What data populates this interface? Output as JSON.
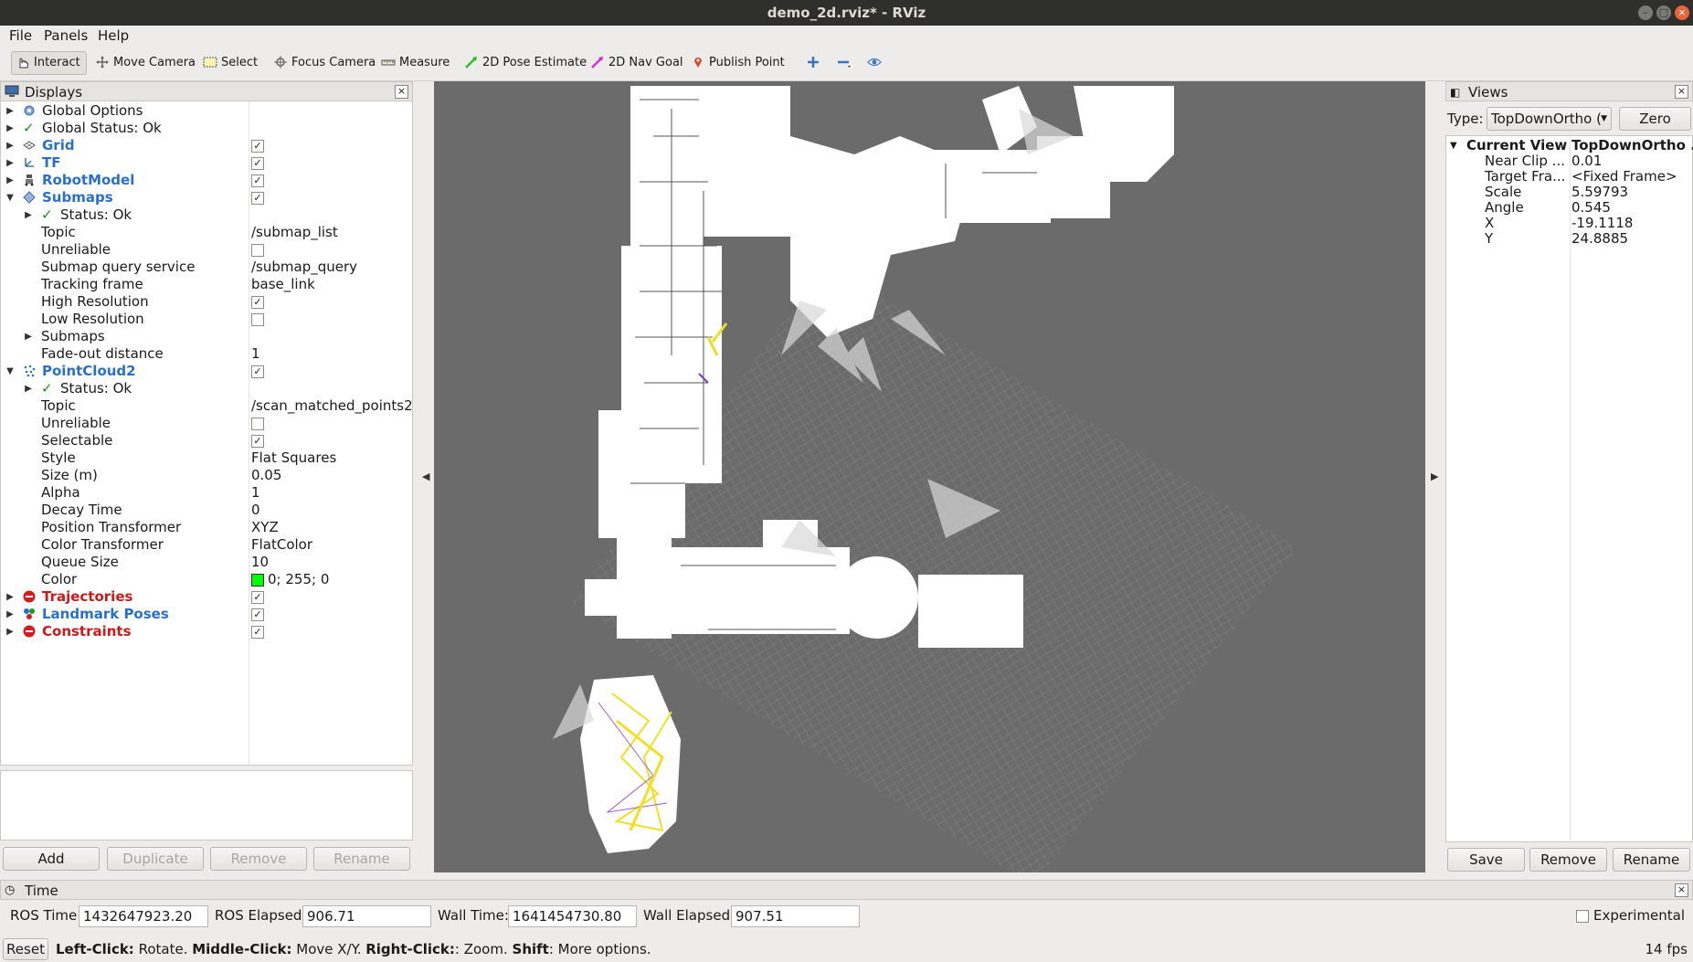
{
  "window": {
    "title": "demo_2d.rviz* - RViz"
  },
  "menu": [
    "File",
    "Panels",
    "Help"
  ],
  "toolbar": {
    "interact": "Interact",
    "move_camera": "Move Camera",
    "select": "Select",
    "focus_camera": "Focus Camera",
    "measure": "Measure",
    "pose_estimate": "2D Pose Estimate",
    "nav_goal": "2D Nav Goal",
    "publish_point": "Publish Point"
  },
  "displays": {
    "title": "Displays",
    "rows": {
      "global_options": "Global Options",
      "global_status": "Global Status: Ok",
      "grid": "Grid",
      "tf": "TF",
      "robot_model": "RobotModel",
      "submaps": "Submaps",
      "submaps_status": "Status: Ok",
      "topic": "Topic",
      "topic_val": "/submap_list",
      "unreliable": "Unreliable",
      "query_service": "Submap query service",
      "query_service_val": "/submap_query",
      "tracking_frame": "Tracking frame",
      "tracking_frame_val": "base_link",
      "high_res": "High Resolution",
      "low_res": "Low Resolution",
      "submaps_child": "Submaps",
      "fade_out": "Fade-out distance",
      "fade_out_val": "1",
      "pointcloud2": "PointCloud2",
      "pc_status": "Status: Ok",
      "pc_topic": "Topic",
      "pc_topic_val": "/scan_matched_points2",
      "pc_unreliable": "Unreliable",
      "selectable": "Selectable",
      "style": "Style",
      "style_val": "Flat Squares",
      "size": "Size (m)",
      "size_val": "0.05",
      "alpha": "Alpha",
      "alpha_val": "1",
      "decay": "Decay Time",
      "decay_val": "0",
      "pos_transformer": "Position Transformer",
      "pos_transformer_val": "XYZ",
      "color_transformer": "Color Transformer",
      "color_transformer_val": "FlatColor",
      "queue_size": "Queue Size",
      "queue_size_val": "10",
      "color": "Color",
      "color_val": "0; 255; 0",
      "trajectories": "Trajectories",
      "landmark_poses": "Landmark Poses",
      "constraints": "Constraints"
    },
    "buttons": {
      "add": "Add",
      "duplicate": "Duplicate",
      "remove": "Remove",
      "rename": "Rename"
    }
  },
  "views": {
    "title": "Views",
    "type_label": "Type:",
    "type_value": "TopDownOrtho (",
    "zero": "Zero",
    "current_view": "Current View",
    "current_view_val": "TopDownOrtho ...",
    "props": [
      {
        "k": "Near Clip ...",
        "v": "0.01"
      },
      {
        "k": "Target Fra...",
        "v": "<Fixed Frame>"
      },
      {
        "k": "Scale",
        "v": "5.59793"
      },
      {
        "k": "Angle",
        "v": "0.545"
      },
      {
        "k": "X",
        "v": "-19.1118"
      },
      {
        "k": "Y",
        "v": "24.8885"
      }
    ],
    "save": "Save",
    "remove": "Remove",
    "rename": "Rename"
  },
  "time": {
    "title": "Time",
    "ros_time_label": "ROS Time:",
    "ros_time": "1432647923.20",
    "ros_elapsed_label": "ROS Elapsed:",
    "ros_elapsed": "906.71",
    "wall_time_label": "Wall Time:",
    "wall_time": "1641454730.80",
    "wall_elapsed_label": "Wall Elapsed:",
    "wall_elapsed": "907.51",
    "experimental": "Experimental"
  },
  "status": {
    "reset": "Reset",
    "left_click": "Left-Click:",
    "left_click_text": " Rotate. ",
    "middle_click": "Middle-Click:",
    "middle_click_text": " Move X/Y. ",
    "right_click": "Right-Click:",
    "right_click_text": ": Zoom. ",
    "shift": "Shift",
    "shift_text": ": More options.",
    "fps": "14 fps"
  },
  "colors": {
    "accent_blue": "#2a6fc9",
    "error_red": "#cc1b1b",
    "pointcloud_color": "#00ff00"
  }
}
